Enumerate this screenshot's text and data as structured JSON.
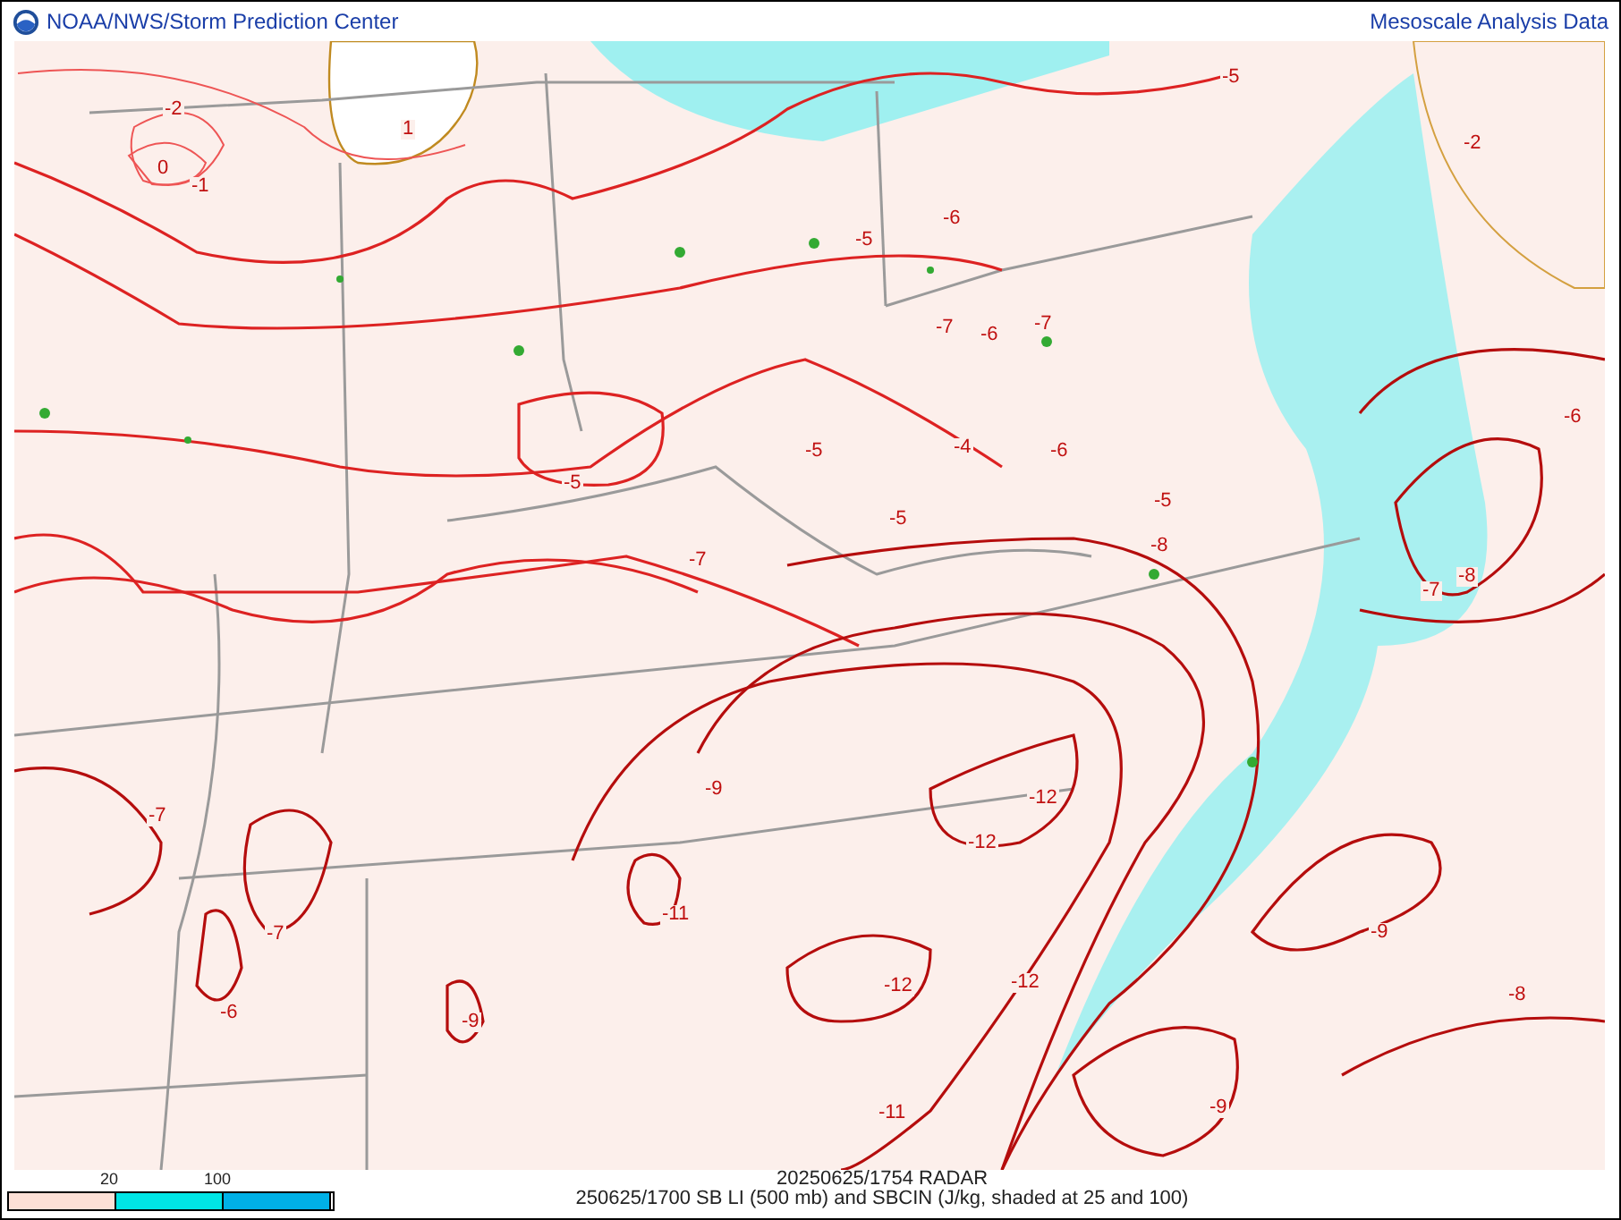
{
  "header": {
    "title": "NOAA/NWS/Storm Prediction Center",
    "product": "Mesoscale Analysis Data"
  },
  "map": {
    "contour_labels": [
      "-2",
      "0",
      "-1",
      "1",
      "-5",
      "-7",
      "-5",
      "-5",
      "-6",
      "-7",
      "-6",
      "-7",
      "-5",
      "-4",
      "-6",
      "-5",
      "-5",
      "-8",
      "-2",
      "-6",
      "-7",
      "-8",
      "-9",
      "-12",
      "-12",
      "-11",
      "-7",
      "-7",
      "-6",
      "-9",
      "-12",
      "-12",
      "-11",
      "-9",
      "-9",
      "-8"
    ]
  },
  "legend": {
    "segments": [
      {
        "color": "#fde0d6"
      },
      {
        "color": "#00e5e5"
      },
      {
        "color": "#00b0e6"
      }
    ],
    "ticks": [
      "20",
      "100"
    ]
  },
  "footer": {
    "radar_time": "20250625/1754 RADAR",
    "caption": "250625/1700 SB LI (500 mb) and SBCIN (J/kg, shaded at 25 and 100)"
  }
}
